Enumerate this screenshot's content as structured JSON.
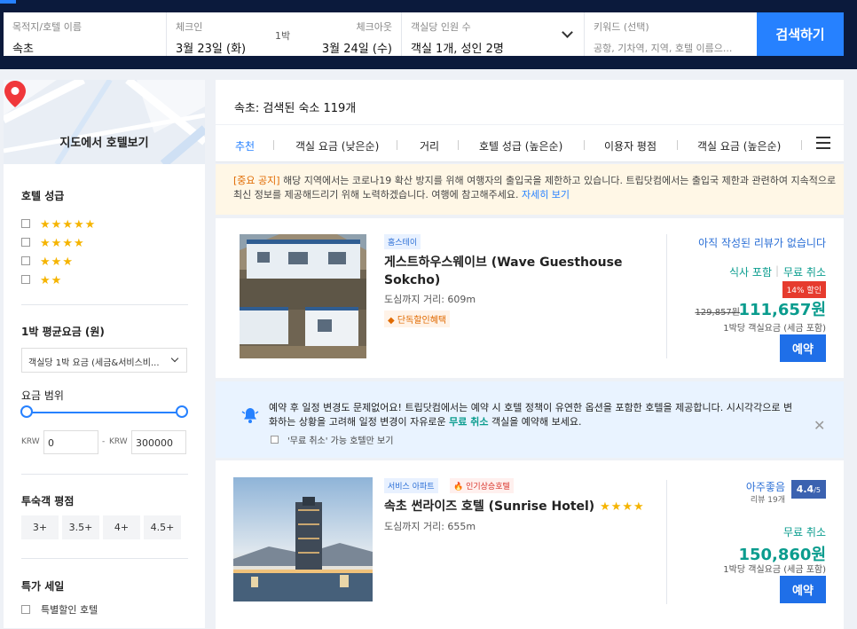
{
  "search": {
    "destination_label": "목적지/호텔 이름",
    "destination_value": "속초",
    "checkin_label": "체크인",
    "checkin_value": "3월 23일 (화)",
    "nights": "1박",
    "checkout_label": "체크아웃",
    "checkout_value": "3월 24일 (수)",
    "guests_label": "객실당 인원 수",
    "guests_value": "객실 1개, 성인 2명",
    "keyword_label": "키워드 (선택)",
    "keyword_placeholder": "공항, 기차역, 지역, 호텔 이름으...",
    "button": "검색하기"
  },
  "sidebar": {
    "map_label": "지도에서 호텔보기",
    "star_title": "호텔 성급",
    "star_options": [
      5,
      4,
      3,
      2
    ],
    "avg_price_title": "1박 평균요금 (원)",
    "price_select": "객실당 1박 요금 (세금&서비스비...",
    "range_title": "요금 범위",
    "currency": "KRW",
    "min_price": "0",
    "max_price": "300000",
    "rating_title": "투숙객 평점",
    "rating_buttons": [
      "3+",
      "3.5+",
      "4+",
      "4.5+"
    ],
    "deal_title": "특가 세일",
    "deal_option": "특별할인 호텔"
  },
  "results": {
    "count_text": "속초: 검색된 숙소 119개",
    "sort_tabs": [
      "추천",
      "객실 요금 (낮은순)",
      "거리",
      "호텔 성급 (높은순)",
      "이용자 평점",
      "객실 요금 (높은순)"
    ]
  },
  "notice": {
    "tag": "[중요 공지]",
    "text": "해당 지역에서는 코로나19 확산 방지를 위해 여행자의 출입국을 제한하고 있습니다. 트립닷컴에서는 출입국 제한과 관련하여 지속적으로 최신 정보를 제공해드리기 위해 노력하겠습니다. 여행에 참고해주세요.",
    "link": "자세히 보기"
  },
  "hotels": [
    {
      "type_badge": "홈스테이",
      "name": "게스트하우스웨이브 (Wave Guesthouse Sokcho)",
      "distance": "도심까지 거리: 609m",
      "promo": "단독할인혜택",
      "review": "아직 작성된 리뷰가 없습니다",
      "meal": "식사 포함",
      "cancel": "무료 취소",
      "discount": "14% 할인",
      "old_price": "129,857원",
      "price": "111,657원",
      "price_note": "1박당 객실요금 (세금 포함)",
      "reserve": "예약"
    },
    {
      "type_badge": "서비스 아파트",
      "hot_badge": "인기상승호텔",
      "name": "속초 썬라이즈 호텔 (Sunrise Hotel)",
      "stars": 4,
      "distance": "도심까지 거리: 655m",
      "rating_word": "아주좋음",
      "rating_score": "4.4",
      "rating_max": "/5",
      "review_count": "리뷰 19개",
      "cancel": "무료 취소",
      "price": "150,860원",
      "price_note": "1박당 객실요금 (세금 포함)",
      "reserve": "예약"
    }
  ],
  "banner": {
    "text1": "예약 후 일정 변경도 문제없어요! 트립닷컴에서는 예약 시 호텔 정책이 유연한 옵션을 포함한 호텔을 제공합니다. 시시각각으로 변화하는 상황을 고려해 일정 변경이 자유로운 ",
    "link": "무료 취소",
    "text2": " 객실을 예약해 보세요.",
    "checkbox": "'무료 취소' 가능 호텔만 보기"
  }
}
